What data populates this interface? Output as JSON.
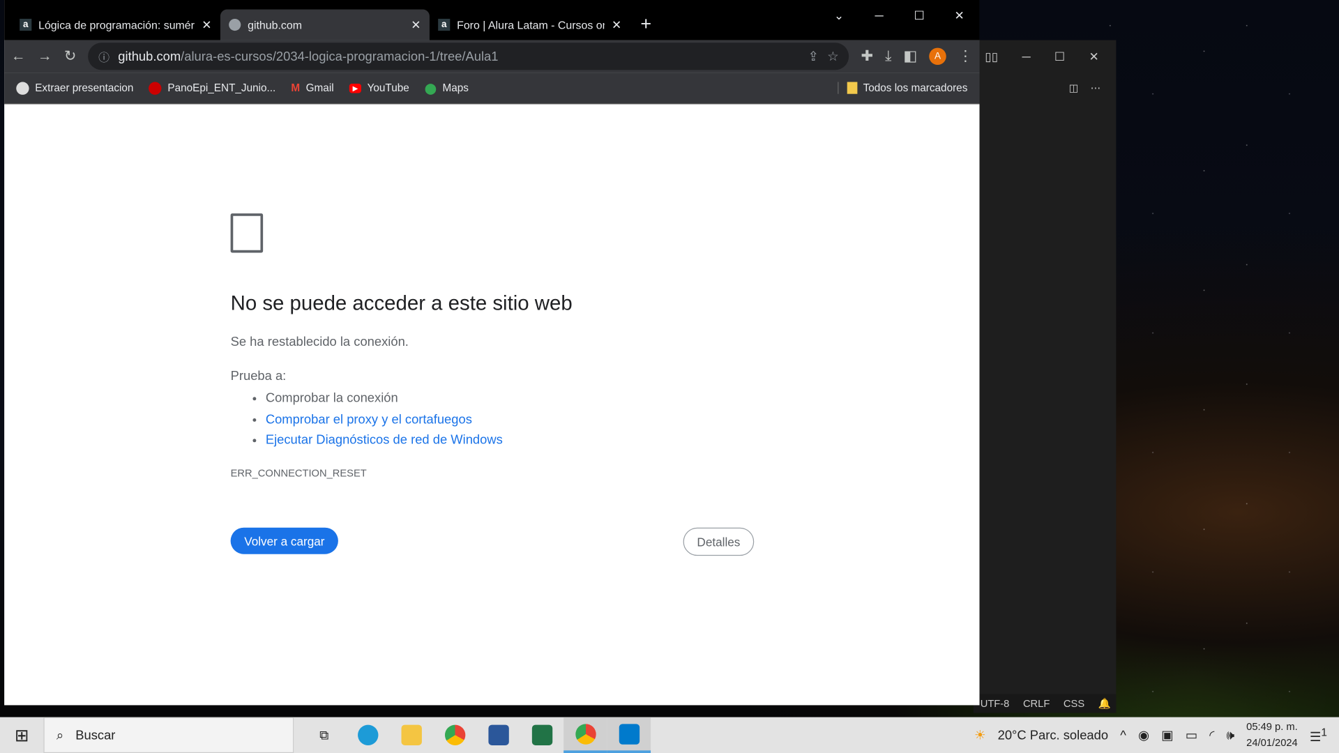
{
  "browser": {
    "tabs": [
      {
        "title": "Lógica de programación: suméroe",
        "icon": "alura-icon"
      },
      {
        "title": "github.com",
        "icon": "globe-icon",
        "active": true
      },
      {
        "title": "Foro | Alura Latam - Cursos online",
        "icon": "alura-icon"
      }
    ],
    "url_host": "github.com",
    "url_path": "/alura-es-cursos/2034-logica-programacion-1/tree/Aula1",
    "profile_initial": "A",
    "bookmarks": [
      {
        "label": "Extraer presentacion"
      },
      {
        "label": "PanoEpi_ENT_Junio..."
      },
      {
        "label": "Gmail"
      },
      {
        "label": "YouTube"
      },
      {
        "label": "Maps"
      }
    ],
    "all_bookmarks": "Todos los marcadores"
  },
  "error": {
    "title": "No se puede acceder a este sitio web",
    "message": "Se ha restablecido la conexión.",
    "try_label": "Prueba a:",
    "suggestions": [
      "Comprobar la conexión",
      "Comprobar el proxy y el cortafuegos",
      "Ejecutar Diagnósticos de red de Windows"
    ],
    "code": "ERR_CONNECTION_RESET",
    "reload": "Volver a cargar",
    "details": "Detalles"
  },
  "vscode": {
    "status": [
      "UTF-8",
      "CRLF",
      "CSS"
    ]
  },
  "taskbar": {
    "search": "Buscar",
    "weather": "20°C  Parc. soleado",
    "time": "05:49 p. m.",
    "date": "24/01/2024",
    "notifications": "1"
  },
  "colors": {
    "accent": "#1a73e8",
    "profile": "#e8710a"
  }
}
